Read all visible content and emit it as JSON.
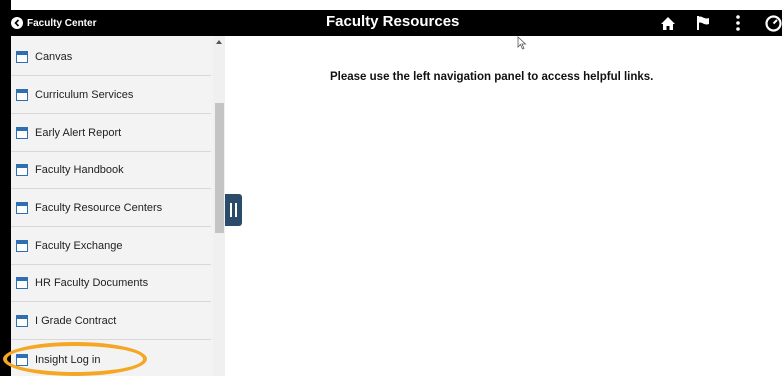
{
  "header": {
    "back_label": "Faculty Center",
    "title": "Faculty Resources",
    "icons": [
      "home-icon",
      "flag-icon",
      "more-icon",
      "navbar-icon"
    ]
  },
  "sidebar": {
    "items": [
      {
        "label": "Canvas"
      },
      {
        "label": "Curriculum Services"
      },
      {
        "label": "Early Alert Report"
      },
      {
        "label": "Faculty Handbook"
      },
      {
        "label": "Faculty Resource Centers"
      },
      {
        "label": "Faculty Exchange"
      },
      {
        "label": "HR Faculty Documents"
      },
      {
        "label": "I Grade Contract"
      },
      {
        "label": "Insight Log in"
      }
    ]
  },
  "main": {
    "message": "Please use the left navigation panel to access helpful links."
  },
  "colors": {
    "header_bg": "#000000",
    "sidebar_bg": "#f3f3f3",
    "handle": "#2b4b6b",
    "highlight": "#f5a623",
    "nav_icon": "#2f6fb0"
  }
}
